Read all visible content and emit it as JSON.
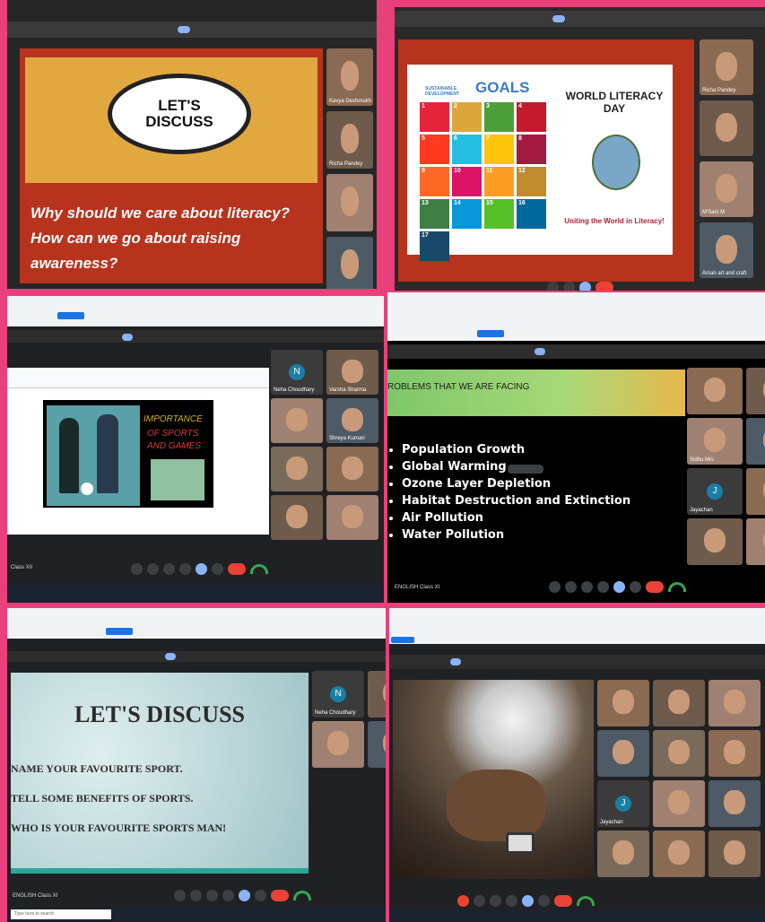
{
  "panel1": {
    "bubble_text": "LET'S DISCUSS",
    "question": "Why should we care about literacy? How can we go about raising awareness?",
    "participants": [
      {
        "name": "Kavya Deshmukh"
      },
      {
        "name": "Richa Pandey"
      },
      {
        "name": ""
      },
      {
        "name": ""
      }
    ]
  },
  "panel2": {
    "sdg_title_small": "SUSTAINABLE DEVELOPMENT",
    "sdg_title_big": "GOALS",
    "wld_top": "WORLD LITERACY DAY",
    "wld_bottom": "Uniting the World in Literacy!",
    "sdg_tiles": [
      {
        "num": "1",
        "color": "#e5243b"
      },
      {
        "num": "2",
        "color": "#dda63a"
      },
      {
        "num": "3",
        "color": "#4c9f38"
      },
      {
        "num": "4",
        "color": "#c5192d"
      },
      {
        "num": "5",
        "color": "#ff3a21"
      },
      {
        "num": "6",
        "color": "#26bde2"
      },
      {
        "num": "7",
        "color": "#fcc30b"
      },
      {
        "num": "8",
        "color": "#a21942"
      },
      {
        "num": "9",
        "color": "#fd6925"
      },
      {
        "num": "10",
        "color": "#dd1367"
      },
      {
        "num": "11",
        "color": "#fd9d24"
      },
      {
        "num": "12",
        "color": "#bf8b2e"
      },
      {
        "num": "13",
        "color": "#3f7e44"
      },
      {
        "num": "14",
        "color": "#0a97d9"
      },
      {
        "num": "15",
        "color": "#56c02b"
      },
      {
        "num": "16",
        "color": "#00689d"
      },
      {
        "num": "17",
        "color": "#19486a"
      }
    ],
    "participants": [
      {
        "name": "Richa Pandey"
      },
      {
        "name": ""
      },
      {
        "name": "M'Sam M"
      },
      {
        "name": "Aman art and craft"
      }
    ]
  },
  "panel3": {
    "title_line1": "IMPORTANCE",
    "title_line2": "OF SPORTS",
    "title_line3": "AND GAMES",
    "meeting_name": "Class XII",
    "participants": [
      {
        "name": "Neha Choudhary",
        "avatar": "N"
      },
      {
        "name": "Varsha Sharma"
      },
      {
        "name": ""
      },
      {
        "name": "Shreya Kumari"
      },
      {
        "name": ""
      },
      {
        "name": ""
      },
      {
        "name": ""
      },
      {
        "name": ""
      }
    ]
  },
  "panel4": {
    "heading": "ROBLEMS THAT WE ARE FACING",
    "bullets": [
      "Population Growth",
      "Global Warming",
      "Ozone Layer Depletion",
      "Habitat Destruction and Extinction",
      "Air Pollution",
      "Water Pollution"
    ],
    "meeting_name": "ENGLISH Class XI",
    "participants": [
      {
        "name": ""
      },
      {
        "name": ""
      },
      {
        "name": "Sidhu Mrs"
      },
      {
        "name": ""
      },
      {
        "name": "Jayachan",
        "avatar": "J"
      },
      {
        "name": ""
      },
      {
        "name": ""
      },
      {
        "name": ""
      }
    ]
  },
  "panel5": {
    "heading": "LET'S DISCUSS",
    "items": [
      "NAME YOUR FAVOURITE SPORT.",
      "TELL SOME BENEFITS OF SPORTS.",
      "WHO IS YOUR FAVOURITE SPORTS MAN!"
    ],
    "meeting_name": "ENGLISH Class XI",
    "search_placeholder": "Type here to search",
    "participants": [
      {
        "name": "Neha Choudhary",
        "avatar": "N"
      },
      {
        "name": ""
      },
      {
        "name": ""
      },
      {
        "name": ""
      }
    ]
  },
  "panel6": {
    "participants": [
      {
        "name": ""
      },
      {
        "name": ""
      },
      {
        "name": ""
      },
      {
        "name": ""
      },
      {
        "name": ""
      },
      {
        "name": ""
      },
      {
        "name": "Jayachan",
        "avatar": "J"
      },
      {
        "name": ""
      },
      {
        "name": ""
      },
      {
        "name": ""
      },
      {
        "name": ""
      },
      {
        "name": ""
      }
    ]
  }
}
